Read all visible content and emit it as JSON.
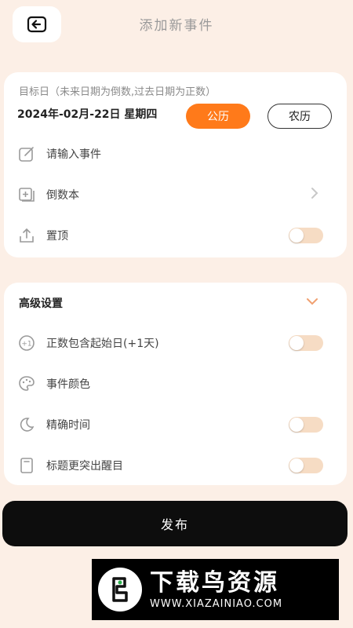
{
  "header": {
    "title": "添加新事件"
  },
  "target": {
    "hint": "目标日（未来日期为倒数,过去日期为正数）",
    "date": "2024年-02月-22日  星期四",
    "solar_label": "公历",
    "lunar_label": "农历"
  },
  "basic_rows": [
    {
      "label": "请输入事件",
      "icon": "edit-icon"
    },
    {
      "label": "倒数本",
      "icon": "notebook-icon"
    },
    {
      "label": "置顶",
      "icon": "upload-icon",
      "toggle": false
    }
  ],
  "advanced": {
    "title": "高级设置",
    "rows": [
      {
        "label": "正数包含起始日(+1天)",
        "icon": "plus-one-icon",
        "toggle": false
      },
      {
        "label": "事件颜色",
        "icon": "palette-icon"
      },
      {
        "label": "精确时间",
        "icon": "moon-icon",
        "toggle": false
      },
      {
        "label": "标题更突出醒目",
        "icon": "phone-icon",
        "toggle": false
      }
    ]
  },
  "publish_label": "发布",
  "watermark": {
    "name": "下载鸟资源",
    "url": "WWW.XIAZAINIAO.COM"
  },
  "colors": {
    "accent": "#ff7a1a",
    "background": "#fcefe6",
    "toggle_off": "#f6dcc4"
  }
}
